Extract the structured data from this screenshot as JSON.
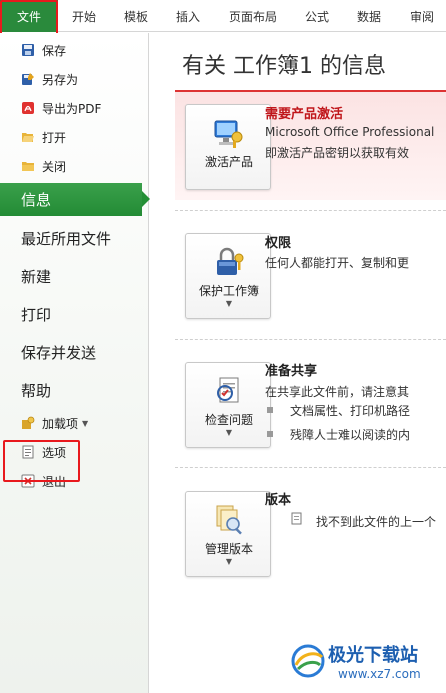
{
  "ribbon": {
    "file_tab": "文件",
    "tabs": [
      "开始",
      "模板",
      "插入",
      "页面布局",
      "公式",
      "数据",
      "审阅"
    ]
  },
  "sidebar": {
    "commands_top": [
      "保存",
      "另存为",
      "导出为PDF",
      "打开",
      "关闭"
    ],
    "active_item": "信息",
    "nav_items": [
      "最近所用文件",
      "新建",
      "打印",
      "保存并发送",
      "帮助"
    ],
    "addins": "加载项",
    "options": "选项",
    "exit": "退出"
  },
  "main": {
    "title": "有关 工作簿1 的信息",
    "activation": {
      "button_label": "激活产品",
      "heading": "需要产品激活",
      "line1": "Microsoft Office Professional",
      "line2": "即激活产品密钥以获取有效"
    },
    "permissions": {
      "button_label": "保护工作簿",
      "heading": "权限",
      "text": "任何人都能打开、复制和更"
    },
    "prepare": {
      "button_label": "检查问题",
      "heading": "准备共享",
      "text": "在共享此文件前，请注意其",
      "bullets": [
        "文档属性、打印机路径",
        "残障人士难以阅读的内"
      ]
    },
    "versions": {
      "button_label": "管理版本",
      "heading": "版本",
      "text": "找不到此文件的上一个"
    }
  },
  "watermark": {
    "text": "极光下载站",
    "url": "www.xz7.com"
  },
  "colors": {
    "accent_green": "#2a8a3c",
    "highlight_red": "#e8191d",
    "warning_red": "#c0161b",
    "activation_banner": "#fbe3e3"
  }
}
